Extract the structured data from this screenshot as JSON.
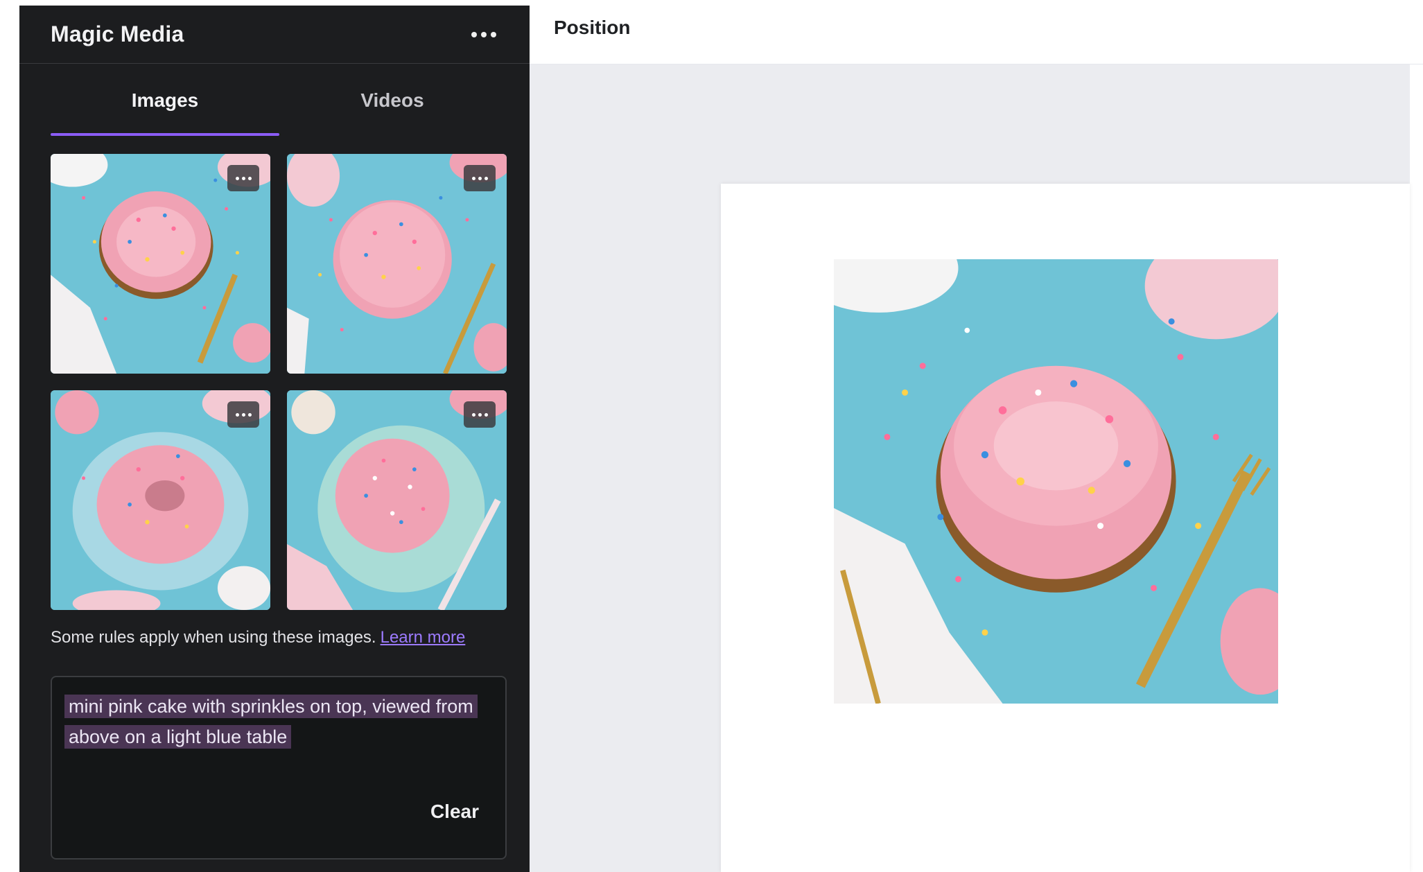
{
  "panel": {
    "title": "Magic Media",
    "tabs": [
      {
        "label": "Images",
        "active": true
      },
      {
        "label": "Videos",
        "active": false
      }
    ],
    "rules_text": "Some rules apply when using these images.",
    "learn_more": "Learn more",
    "prompt": "mini pink cake with sprinkles on top, viewed from above on a light blue table",
    "clear_label": "Clear"
  },
  "toolbar": {
    "position_label": "Position"
  },
  "colors": {
    "accent": "#8b5cf6",
    "panel_bg": "#1c1d1f",
    "canvas_bg": "#ebecf0",
    "table_blue": "#6fc3d6",
    "cake_pink": "#f0a2b4"
  }
}
